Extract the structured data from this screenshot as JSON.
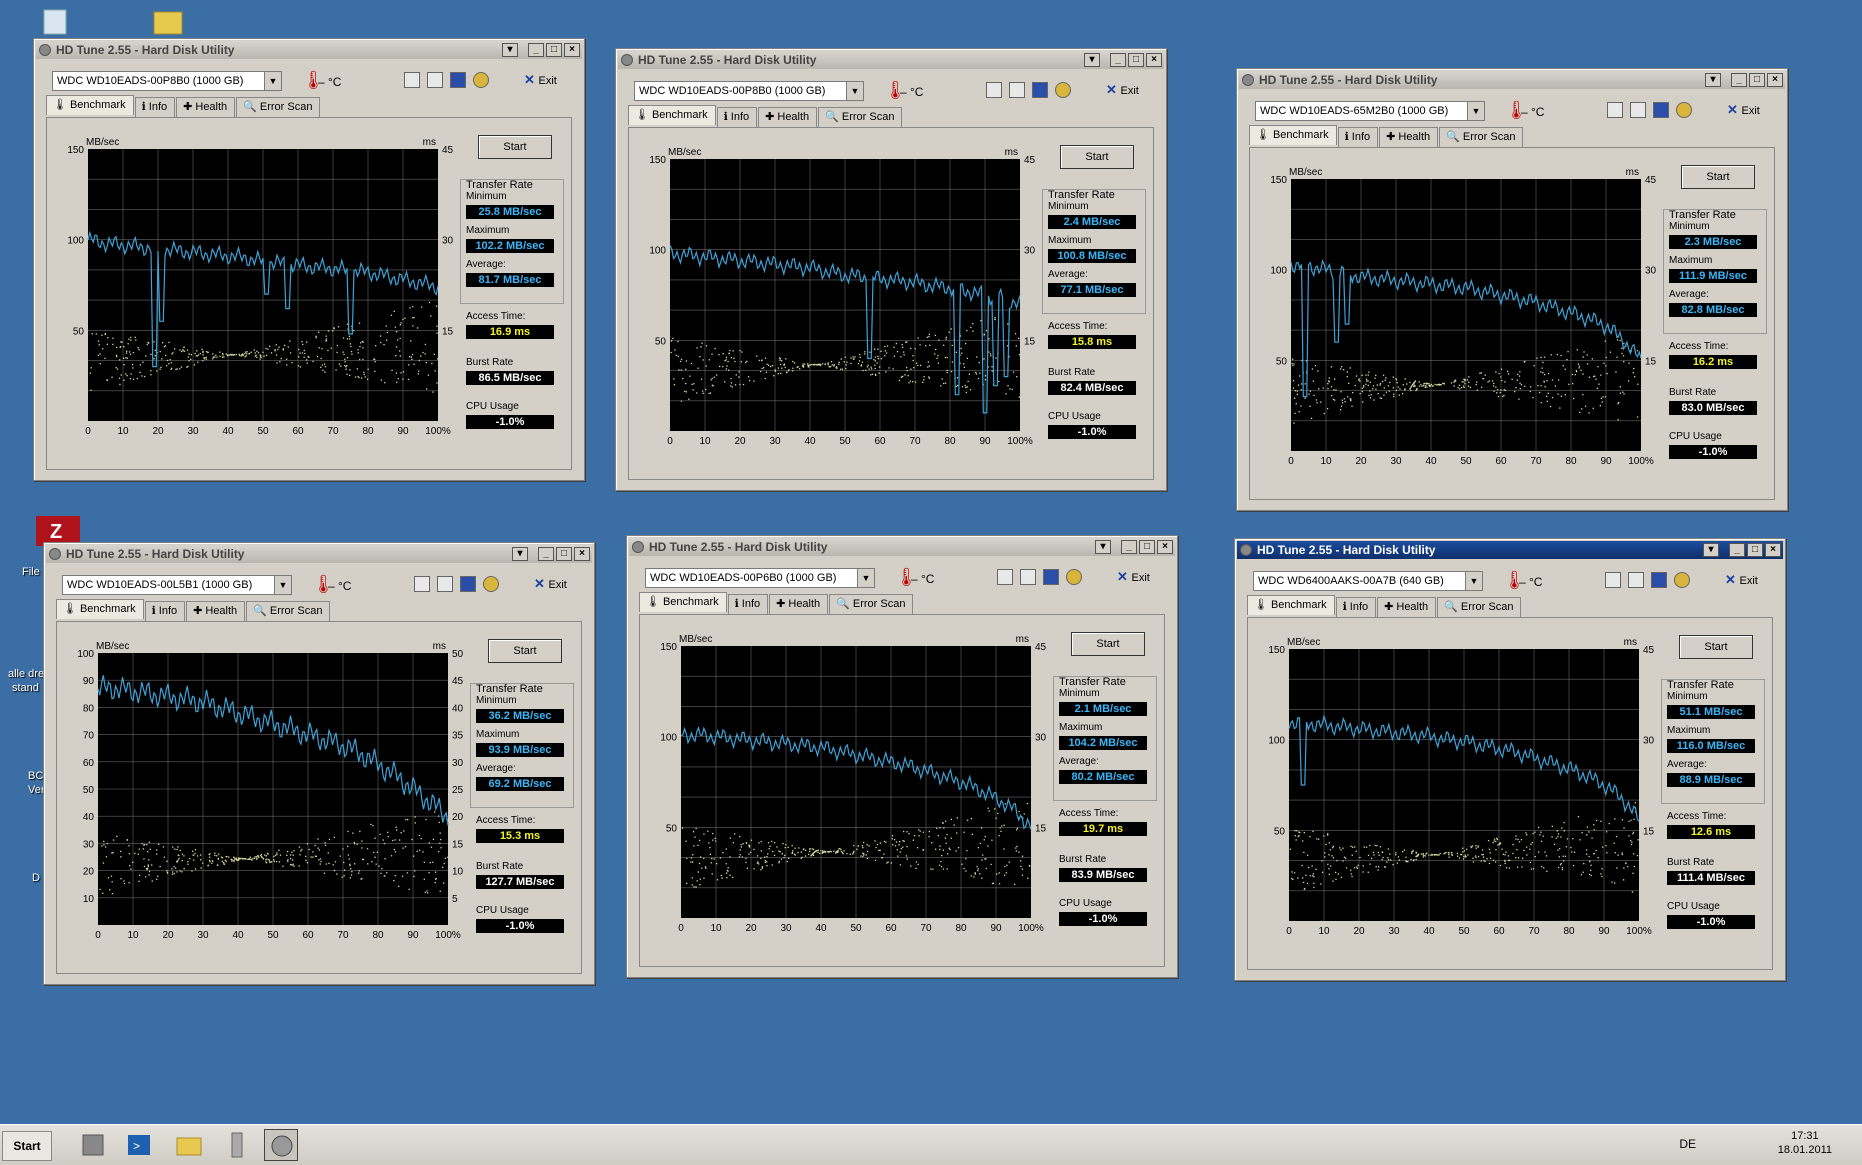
{
  "desktop": {
    "labels": [
      "File",
      "alle dre",
      "stand",
      "BC",
      "Ver",
      "D"
    ]
  },
  "app": {
    "title": "HD Tune 2.55 - Hard Disk Utility",
    "temp": "– °C",
    "exit": "Exit",
    "start": "Start",
    "tabs": [
      "Benchmark",
      "Info",
      "Health",
      "Error Scan"
    ],
    "unit_left": "MB/sec",
    "unit_right": "ms",
    "labels": {
      "transfer_rate": "Transfer Rate",
      "minimum": "Minimum",
      "maximum": "Maximum",
      "average": "Average:",
      "access_time": "Access Time:",
      "burst_rate": "Burst Rate",
      "cpu_usage": "CPU Usage"
    }
  },
  "windows": [
    {
      "drive": "WDC WD10EADS-00P8B0 (1000 GB)",
      "min": "25.8 MB/sec",
      "max": "102.2 MB/sec",
      "avg": "81.7 MB/sec",
      "access": "16.9 ms",
      "burst": "86.5 MB/sec",
      "cpu": "-1.0%",
      "active": false,
      "chart_data": {
        "type": "line",
        "ylim": [
          0,
          150
        ],
        "y2lim": [
          0,
          45
        ],
        "yticks": [
          "150",
          "100",
          "50"
        ],
        "y2ticks": [
          "45",
          "30",
          "15"
        ],
        "x": [
          0,
          5,
          10,
          15,
          20,
          25,
          30,
          35,
          40,
          45,
          50,
          55,
          60,
          65,
          70,
          75,
          80,
          85,
          90,
          95,
          100
        ],
        "values": [
          100,
          98,
          97,
          96,
          95,
          94,
          93,
          92,
          91,
          90,
          88,
          87,
          86,
          85,
          84,
          83,
          82,
          80,
          78,
          76,
          74
        ],
        "dips": [
          [
            19,
            30
          ],
          [
            21,
            55
          ],
          [
            51,
            70
          ],
          [
            75,
            48
          ],
          [
            57,
            62
          ]
        ]
      }
    },
    {
      "drive": "WDC WD10EADS-00P8B0 (1000 GB)",
      "min": "2.4 MB/sec",
      "max": "100.8 MB/sec",
      "avg": "77.1 MB/sec",
      "access": "15.8 ms",
      "burst": "82.4 MB/sec",
      "cpu": "-1.0%",
      "active": false,
      "chart_data": {
        "type": "line",
        "ylim": [
          0,
          150
        ],
        "y2lim": [
          0,
          45
        ],
        "yticks": [
          "150",
          "100",
          "50"
        ],
        "y2ticks": [
          "45",
          "30",
          "15"
        ],
        "x": [
          0,
          5,
          10,
          15,
          20,
          25,
          30,
          35,
          40,
          45,
          50,
          55,
          60,
          65,
          70,
          75,
          80,
          85,
          90,
          95,
          100
        ],
        "values": [
          98,
          97,
          96,
          95,
          94,
          93,
          92,
          91,
          90,
          88,
          86,
          85,
          84,
          83,
          82,
          80,
          79,
          77,
          75,
          73,
          70
        ],
        "dips": [
          [
            57,
            40
          ],
          [
            82,
            20
          ],
          [
            90,
            10
          ],
          [
            93,
            25
          ],
          [
            96,
            30
          ]
        ]
      }
    },
    {
      "drive": "WDC WD10EADS-65M2B0 (1000 GB)",
      "min": "2.3 MB/sec",
      "max": "111.9 MB/sec",
      "avg": "82.8 MB/sec",
      "access": "16.2 ms",
      "burst": "83.0 MB/sec",
      "cpu": "-1.0%",
      "active": false,
      "chart_data": {
        "type": "line",
        "ylim": [
          0,
          150
        ],
        "y2lim": [
          0,
          45
        ],
        "yticks": [
          "150",
          "100",
          "50"
        ],
        "y2ticks": [
          "45",
          "30",
          "15"
        ],
        "x": [
          0,
          5,
          10,
          15,
          20,
          25,
          30,
          35,
          40,
          45,
          50,
          55,
          60,
          65,
          70,
          75,
          80,
          85,
          90,
          95,
          100
        ],
        "values": [
          103,
          102,
          100,
          98,
          96,
          95,
          94,
          93,
          92,
          91,
          90,
          88,
          86,
          84,
          82,
          79,
          76,
          73,
          69,
          61,
          50
        ],
        "dips": [
          [
            4,
            30
          ],
          [
            13,
            60
          ],
          [
            16,
            70
          ]
        ]
      }
    },
    {
      "drive": "WDC WD10EADS-00L5B1 (1000 GB)",
      "min": "36.2 MB/sec",
      "max": "93.9 MB/sec",
      "avg": "69.2 MB/sec",
      "access": "15.3 ms",
      "burst": "127.7 MB/sec",
      "cpu": "-1.0%",
      "active": false,
      "chart_data": {
        "type": "line",
        "ylim": [
          0,
          100
        ],
        "y2lim": [
          0,
          50
        ],
        "yticks": [
          "100",
          "90",
          "80",
          "70",
          "60",
          "50",
          "40",
          "30",
          "20",
          "10"
        ],
        "y2ticks": [
          "50",
          "45",
          "40",
          "35",
          "30",
          "25",
          "20",
          "15",
          "10",
          "5"
        ],
        "x": [
          0,
          5,
          10,
          15,
          20,
          25,
          30,
          35,
          40,
          45,
          50,
          55,
          60,
          65,
          70,
          75,
          80,
          85,
          90,
          95,
          100
        ],
        "values": [
          87,
          87,
          86,
          85,
          84,
          83,
          82,
          80,
          78,
          76,
          74,
          72,
          70,
          68,
          66,
          63,
          59,
          55,
          50,
          45,
          40
        ],
        "dips": []
      }
    },
    {
      "drive": "WDC WD10EADS-00P6B0 (1000 GB)",
      "min": "2.1 MB/sec",
      "max": "104.2 MB/sec",
      "avg": "80.2 MB/sec",
      "access": "19.7 ms",
      "burst": "83.9 MB/sec",
      "cpu": "-1.0%",
      "active": false,
      "chart_data": {
        "type": "line",
        "ylim": [
          0,
          150
        ],
        "y2lim": [
          0,
          45
        ],
        "yticks": [
          "150",
          "100",
          "50"
        ],
        "y2ticks": [
          "45",
          "30",
          "15"
        ],
        "x": [
          0,
          5,
          10,
          15,
          20,
          25,
          30,
          35,
          40,
          45,
          50,
          55,
          60,
          65,
          70,
          75,
          80,
          85,
          90,
          95,
          100
        ],
        "values": [
          101,
          101,
          100,
          99,
          98,
          97,
          96,
          95,
          94,
          92,
          90,
          88,
          86,
          84,
          81,
          78,
          75,
          71,
          66,
          60,
          50
        ],
        "dips": []
      }
    },
    {
      "drive": "WDC WD6400AAKS-00A7B (640 GB)",
      "min": "51.1 MB/sec",
      "max": "116.0 MB/sec",
      "avg": "88.9 MB/sec",
      "access": "12.6 ms",
      "burst": "111.4 MB/sec",
      "cpu": "-1.0%",
      "active": true,
      "chart_data": {
        "type": "line",
        "ylim": [
          0,
          150
        ],
        "y2lim": [
          0,
          45
        ],
        "yticks": [
          "150",
          "100",
          "50"
        ],
        "y2ticks": [
          "45",
          "30",
          "15"
        ],
        "x": [
          0,
          5,
          10,
          15,
          20,
          25,
          30,
          35,
          40,
          45,
          50,
          55,
          60,
          65,
          70,
          75,
          80,
          85,
          90,
          95,
          100
        ],
        "values": [
          110,
          109,
          108,
          107,
          106,
          105,
          104,
          103,
          102,
          100,
          99,
          97,
          95,
          93,
          90,
          87,
          84,
          80,
          75,
          68,
          56
        ],
        "dips": [
          [
            4,
            75
          ]
        ]
      }
    }
  ],
  "taskbar": {
    "start": "Start",
    "lang": "DE",
    "time": "17:31",
    "date": "18.01.2011"
  }
}
